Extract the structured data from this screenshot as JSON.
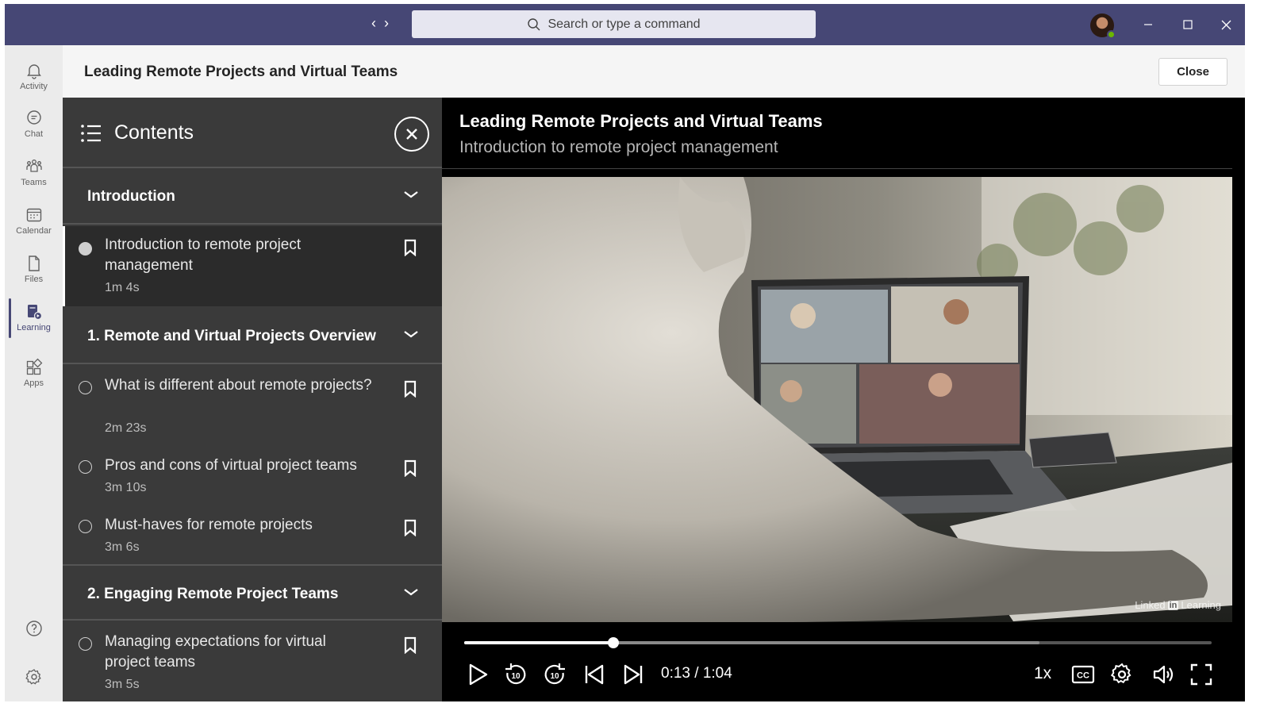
{
  "titlebar": {
    "back_glyph": "‹",
    "forward_glyph": "›",
    "search_placeholder": "Search or type a command"
  },
  "rail": {
    "items": [
      {
        "label": "Activity",
        "icon": "bell-icon"
      },
      {
        "label": "Chat",
        "icon": "chat-icon"
      },
      {
        "label": "Teams",
        "icon": "teams-icon"
      },
      {
        "label": "Calendar",
        "icon": "calendar-icon"
      },
      {
        "label": "Files",
        "icon": "file-icon"
      },
      {
        "label": "Learning",
        "icon": "learning-icon",
        "active": true
      },
      {
        "label": "Apps",
        "icon": "apps-icon"
      }
    ]
  },
  "header": {
    "title": "Leading Remote Projects and Virtual Teams",
    "close_label": "Close"
  },
  "contents": {
    "title": "Contents",
    "sections": [
      {
        "title": "Introduction"
      },
      {
        "title": "1. Remote and Virtual Projects Overview"
      },
      {
        "title": "2. Engaging Remote Project Teams"
      }
    ],
    "items": [
      {
        "title": "Introduction to remote project management",
        "duration": "1m 4s",
        "current": true
      },
      {
        "title": "What is different about remote projects?",
        "duration": "2m 23s"
      },
      {
        "title": "Pros and cons of virtual project teams",
        "duration": "3m 10s"
      },
      {
        "title": "Must-haves for remote projects",
        "duration": "3m 6s"
      },
      {
        "title": "Managing expectations for virtual project teams",
        "duration": "3m 5s"
      }
    ]
  },
  "video": {
    "course_title": "Leading Remote Projects and Virtual Teams",
    "video_title": "Introduction to remote project management",
    "watermark_brand_left": "Linked",
    "watermark_brand_in": "in",
    "watermark_brand_right": "Learning",
    "progress_fraction": 0.2,
    "buffered_fraction": 0.77,
    "time_display": "0:13 / 1:04",
    "speed": "1x",
    "cc_label": "CC",
    "replay_seconds": "10",
    "forward_seconds": "10"
  },
  "colors": {
    "titlebar": "#464775",
    "panel": "#3a3a3a",
    "video_bg": "#000000",
    "presence": "#6bb700"
  }
}
